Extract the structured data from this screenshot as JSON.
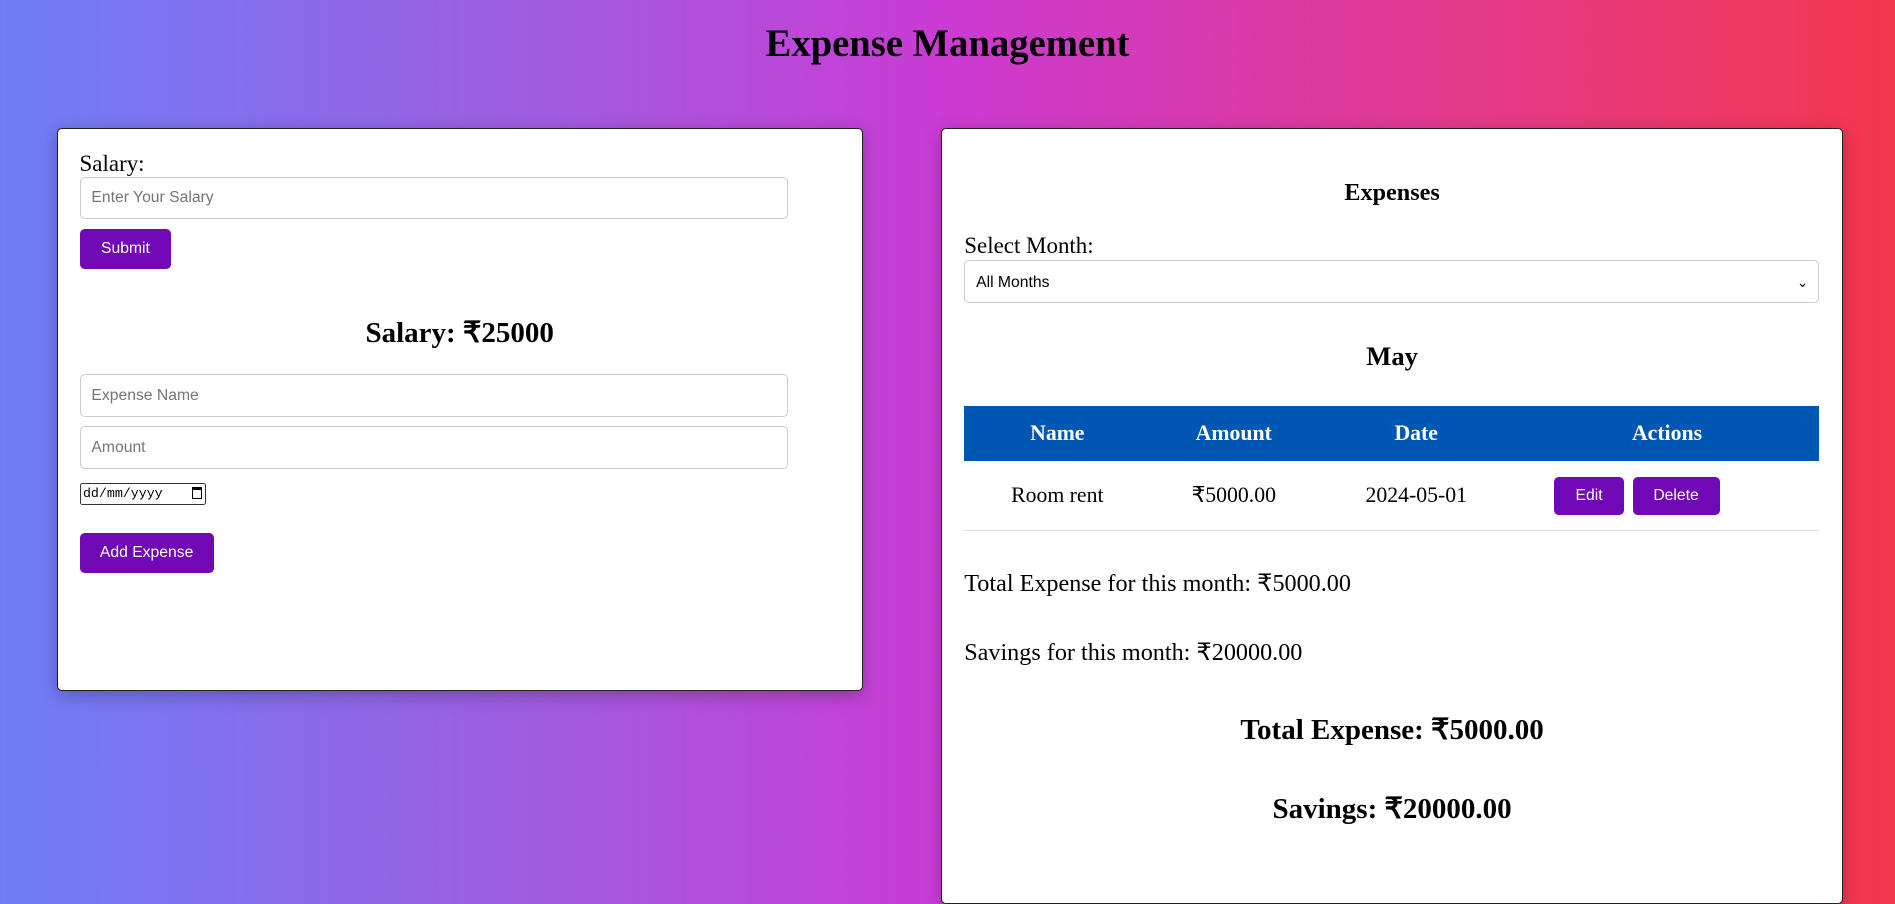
{
  "title": "Expense Management",
  "salary_form": {
    "label": "Salary:",
    "placeholder": "Enter Your Salary",
    "submit": "Submit"
  },
  "salary_display": "Salary: ₹25000",
  "expense_form": {
    "name_placeholder": "Expense Name",
    "amount_placeholder": "Amount",
    "date_placeholder": "dd/mm/yyyy",
    "add": "Add Expense"
  },
  "expenses": {
    "heading": "Expenses",
    "month_label": "Select Month:",
    "month_selected": "All Months",
    "month_heading": "May",
    "columns": [
      "Name",
      "Amount",
      "Date",
      "Actions"
    ],
    "rows": [
      {
        "name": "Room rent",
        "amount": "₹5000.00",
        "date": "2024-05-01",
        "edit": "Edit",
        "delete": "Delete"
      }
    ],
    "month_total": "Total Expense for this month: ₹5000.00",
    "month_savings": "Savings for this month: ₹20000.00",
    "total_expense": "Total Expense: ₹5000.00",
    "total_savings": "Savings: ₹20000.00"
  }
}
